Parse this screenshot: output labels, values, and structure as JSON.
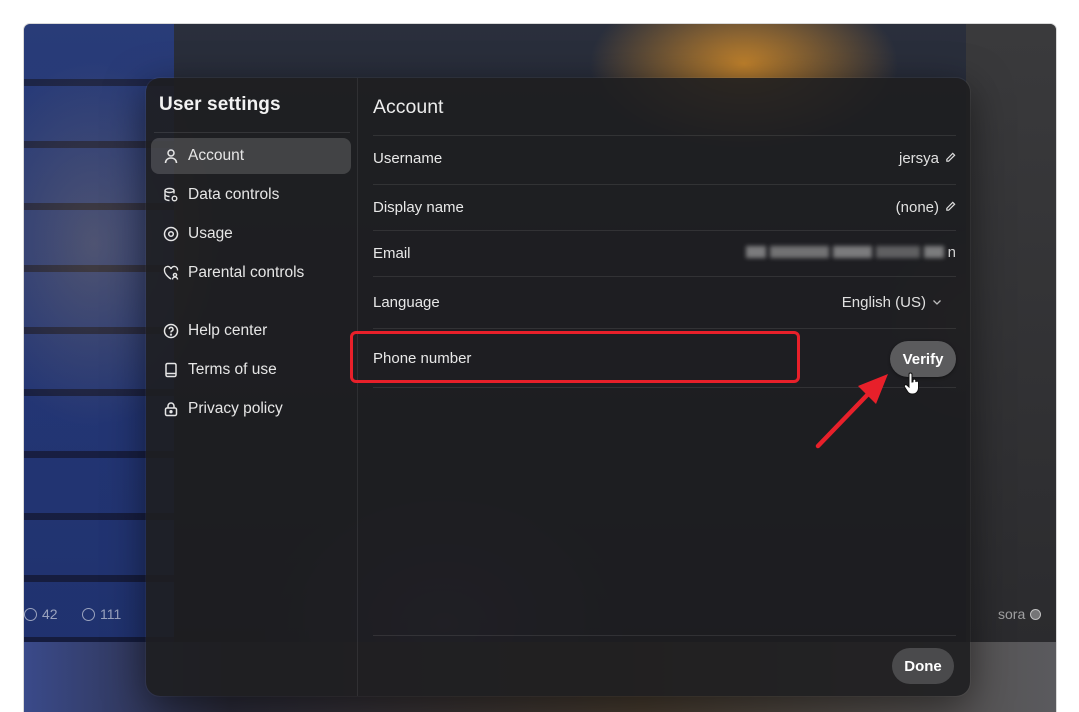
{
  "background": {
    "stats": [
      {
        "icon": "comment-icon",
        "value": "42"
      },
      {
        "icon": "remix-icon",
        "value": "111"
      }
    ],
    "watermark": "sora"
  },
  "sidebar": {
    "title": "User settings",
    "items": [
      {
        "label": "Account",
        "icon": "person-icon",
        "active": true
      },
      {
        "label": "Data controls",
        "icon": "database-gear-icon",
        "active": false
      },
      {
        "label": "Usage",
        "icon": "target-icon",
        "active": false
      },
      {
        "label": "Parental controls",
        "icon": "heart-shield-icon",
        "active": false
      },
      {
        "label": "Help center",
        "icon": "help-circle-icon",
        "active": false
      },
      {
        "label": "Terms of use",
        "icon": "book-icon",
        "active": false
      },
      {
        "label": "Privacy policy",
        "icon": "lock-icon",
        "active": false
      }
    ]
  },
  "account": {
    "title": "Account",
    "rows": {
      "username": {
        "label": "Username",
        "value": "jersya"
      },
      "display_name": {
        "label": "Display name",
        "value": "(none)"
      },
      "email": {
        "label": "Email",
        "value": "n"
      },
      "language": {
        "label": "Language",
        "value": "English (US)"
      },
      "phone": {
        "label": "Phone number",
        "action": "Verify"
      }
    },
    "done_label": "Done"
  },
  "colors": {
    "highlight": "#e8202a",
    "modal_bg": "#1e1e20",
    "button_bg": "#5b5b5d"
  }
}
